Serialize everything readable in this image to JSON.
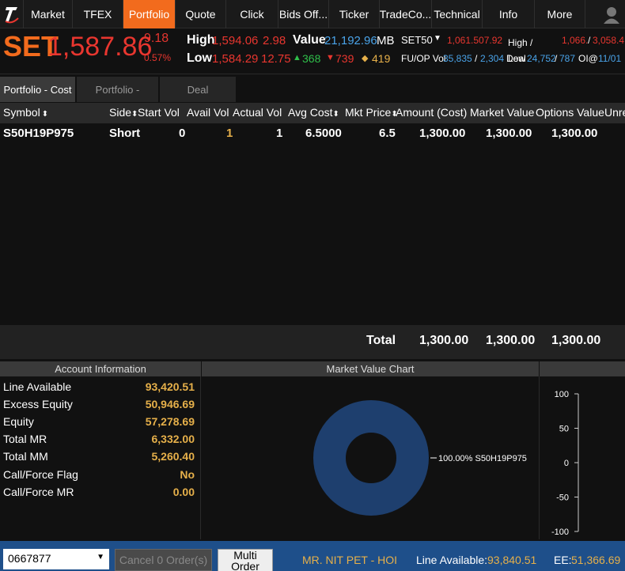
{
  "nav": {
    "tabs": [
      {
        "label": "Market",
        "active": false
      },
      {
        "label": "TFEX",
        "active": false
      },
      {
        "label": "Portfolio",
        "active": true
      },
      {
        "label": "Quote",
        "active": false
      },
      {
        "label": "Click",
        "active": false
      },
      {
        "label": "Bids Off...",
        "active": false
      },
      {
        "label": "Ticker",
        "active": false
      },
      {
        "label": "TradeCo...",
        "active": false
      },
      {
        "label": "Technical",
        "active": false
      },
      {
        "label": "Info",
        "active": false
      },
      {
        "label": "More",
        "active": false
      }
    ]
  },
  "index": {
    "name": "SET",
    "value": "1,587.86",
    "change": "9.18",
    "pct": "0.57%",
    "high_label": "High",
    "high_value": "1,594.06",
    "high_extra": "2.98",
    "low_label": "Low",
    "low_value": "1,584.29",
    "low_extra": "12.75",
    "value_label": "Value",
    "value_amount": "21,192.96",
    "value_unit": "MB",
    "up_count": "368",
    "down_count": "739",
    "unch_count": "419",
    "set50_label": "SET50",
    "set50_value": "1,061.507.92",
    "hl_label": "High / Low",
    "hl_value_a": "1,066.",
    "hl_sep": "/",
    "hl_value_b": "3,058.4",
    "fuop_label": "FU/OP Vol",
    "fuop_a": "35,835",
    "fuop_sep1": "/",
    "fuop_b": "2,304",
    "fuop_c": "Deal",
    "fuop_d": "24,752",
    "fuop_sep2": "/",
    "fuop_e": "787",
    "oi_label": "OI@",
    "oi_value": "11/01"
  },
  "subtabs": [
    {
      "label": "Portfolio - Cost",
      "active": true
    },
    {
      "label": "Portfolio -",
      "active": false
    },
    {
      "label": "Deal",
      "active": false
    }
  ],
  "table": {
    "headers": [
      "Symbol",
      "Side",
      "Start Vol",
      "Avail Vol",
      "Actual Vol",
      "Avg Cost",
      "Mkt Price",
      "Amount (Cost)",
      "Market Value",
      "Options Value",
      "Unrea"
    ],
    "rows": [
      {
        "symbol": "S50H19P975",
        "side": "Short",
        "start_vol": "0",
        "avail_vol": "1",
        "actual_vol": "1",
        "avg_cost": "6.5000",
        "mkt_price": "6.5",
        "amount": "1,300.00",
        "market_value": "1,300.00",
        "options_value": "1,300.00"
      }
    ],
    "total": {
      "label": "Total",
      "amount": "1,300.00",
      "market_value": "1,300.00",
      "options_value": "1,300.00"
    }
  },
  "account": {
    "title": "Account Information",
    "rows": [
      {
        "label": "Line Available",
        "value": "93,420.51"
      },
      {
        "label": "Excess Equity",
        "value": "50,946.69"
      },
      {
        "label": "Equity",
        "value": "57,278.69"
      },
      {
        "label": "Total MR",
        "value": "6,332.00"
      },
      {
        "label": "Total MM",
        "value": "5,260.40"
      },
      {
        "label": "Call/Force Flag",
        "value": "No"
      },
      {
        "label": "Call/Force MR",
        "value": "0.00"
      }
    ]
  },
  "chart_panel": {
    "title": "Market Value Chart"
  },
  "chart_data": [
    {
      "type": "pie",
      "categories": [
        "S50H19P975"
      ],
      "values": [
        100
      ],
      "labels": [
        "100.00% S50H19P975"
      ],
      "color": "#1e3f6e"
    },
    {
      "type": "bar",
      "categories": [],
      "values": [],
      "ylim": [
        -100,
        100
      ],
      "yticks": [
        "100",
        "50",
        "0",
        "-50",
        "-100"
      ]
    }
  ],
  "footer": {
    "account_no": "0667877",
    "cancel_label": "Cancel 0 Order(s)",
    "multi_label_1": "Multi",
    "multi_label_2": "Order",
    "user_name": "MR. NIT PET - HOI",
    "line_label": "Line Available:",
    "line_value": "93,840.51",
    "ee_label": "EE:",
    "ee_value": "51,366.69"
  }
}
